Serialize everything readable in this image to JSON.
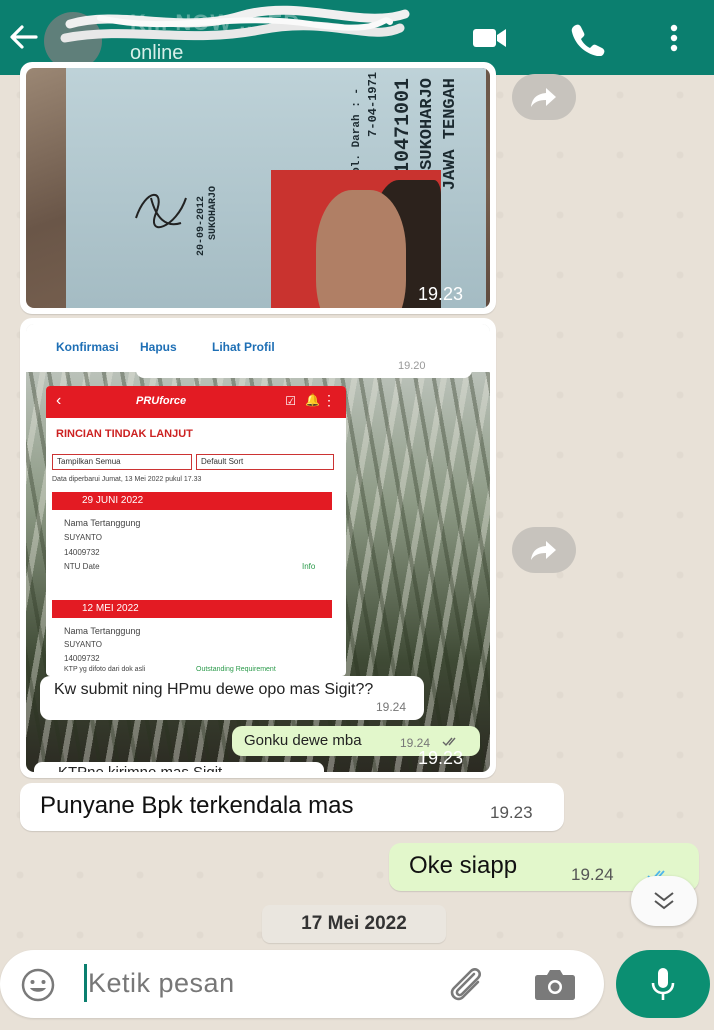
{
  "header": {
    "contact_name": "K... NOW ... ED",
    "status": "online",
    "icons": [
      "back-arrow-icon",
      "video-call-icon",
      "phone-icon",
      "more-vert-icon"
    ],
    "color": "#0b7f6f"
  },
  "messages": {
    "ktp_image": {
      "time": "19.23",
      "card_lines": [
        "JAWA TENGAH",
        "EN SUKOHARJO",
        "7-04-1971",
        "Gol. Darah : -",
        "SUKOHARJO",
        "20-09-2012"
      ],
      "card_number": "10471001"
    },
    "screenshot_image": {
      "time": "19.23",
      "quoted_time": "19.20",
      "links": [
        "Konfirmasi",
        "Hapus",
        "Lihat Profil"
      ],
      "pru": {
        "app_name": "PRUforce",
        "section_title": "RINCIAN TINDAK LANJUT",
        "select_1": "Tampilkan Semua",
        "select_2": "Default Sort",
        "updated": "Data diperbarui Jumat, 13 Mei 2022 pukul 17.33",
        "entries": [
          {
            "date": "29 JUNI 2022",
            "label": "Nama Tertanggung",
            "name": "SUYANTO",
            "number": "14009732",
            "field": "NTU Date",
            "action": "Info"
          },
          {
            "date": "12 MEI 2022",
            "label": "Nama Tertanggung",
            "name": "SUYANTO",
            "number": "14009732",
            "note": "KTP yg difoto dari dok asli",
            "status": "Outstanding Requirement"
          }
        ],
        "inner_time": "19.23"
      },
      "incoming_text": "Kw submit ning HPmu dewe opo mas Sigit??",
      "incoming_time": "19.24",
      "outgoing_text": "Gonku dewe mba",
      "outgoing_time": "19.24",
      "cut_text": "KTPne kirimno mas Sigit"
    },
    "msg_1": {
      "text": "Punyane Bpk terkendala mas",
      "time": "19.23"
    },
    "msg_2": {
      "text": "Oke siapp",
      "time": "19.24"
    }
  },
  "date_chip": "17 Mei 2022",
  "input": {
    "placeholder": "Ketik pesan"
  },
  "colors": {
    "bubble_out": "#e2f7cb",
    "tick_read": "#4fb6ec",
    "accent": "#0b8f72"
  }
}
